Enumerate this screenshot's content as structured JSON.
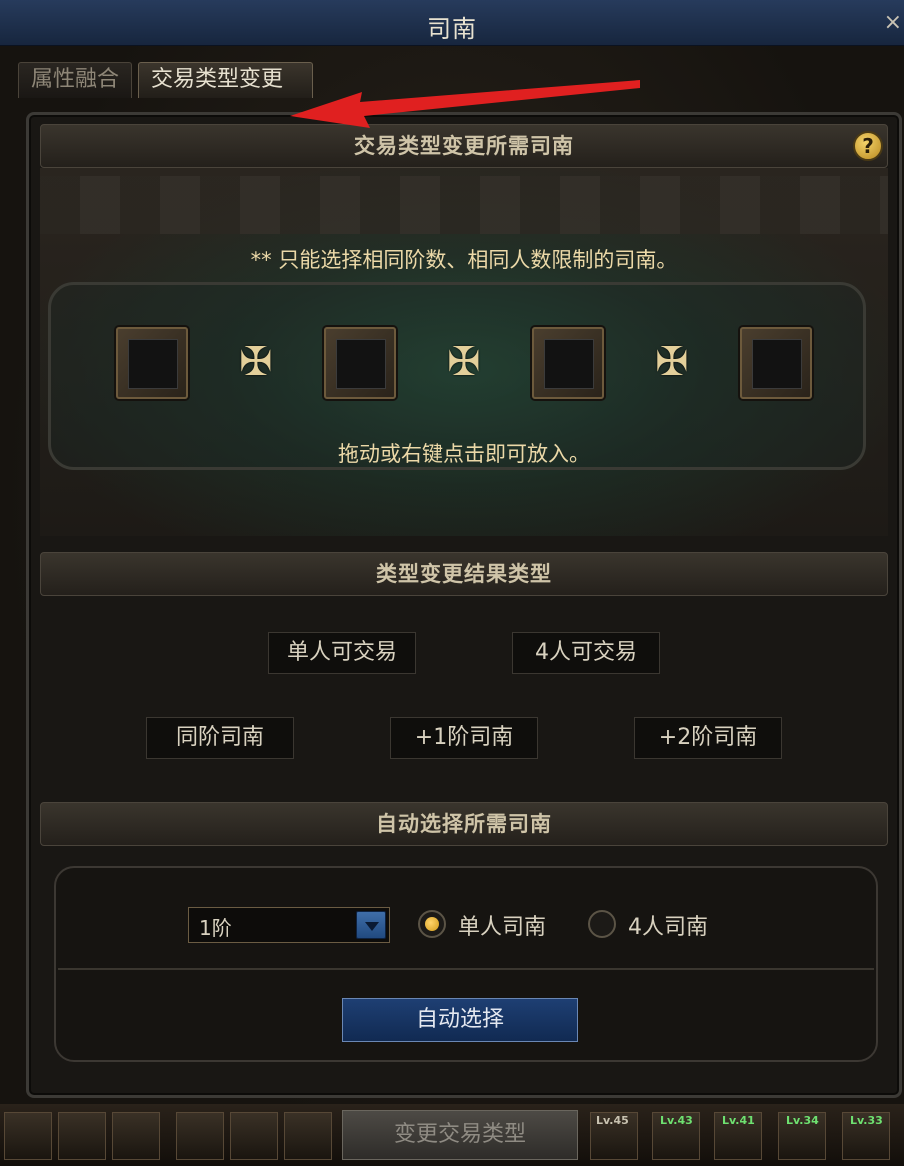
{
  "window": {
    "title": "司南",
    "close": "×"
  },
  "tabs": [
    {
      "label": "属性融合",
      "active": false
    },
    {
      "label": "交易类型变更",
      "active": true
    }
  ],
  "section1": {
    "title": "交易类型变更所需司南",
    "help": "?",
    "notice": "** 只能选择相同阶数、相同人数限制的司南。",
    "hint": "拖动或右键点击即可放入。",
    "plus_glyph": "✠"
  },
  "section2": {
    "title": "类型变更结果类型",
    "trade_options": [
      "单人可交易",
      "4人可交易"
    ],
    "grade_options": [
      "同阶司南",
      "+1阶司南",
      "+2阶司南"
    ]
  },
  "section3": {
    "title": "自动选择所需司南",
    "dropdown_value": "1阶",
    "radio_single": "单人司南",
    "radio_four": "4人司南",
    "selected": "single",
    "auto_button": "自动选择"
  },
  "footer": {
    "change_button": "变更交易类型",
    "badges": [
      "Lv.45",
      "Lv.43",
      "Lv.41",
      "Lv.34",
      "Lv.33"
    ]
  },
  "colors": {
    "accent_gold": "#e3cf9a",
    "button_blue": "#1e3f73",
    "arrow_red": "#e02020"
  }
}
